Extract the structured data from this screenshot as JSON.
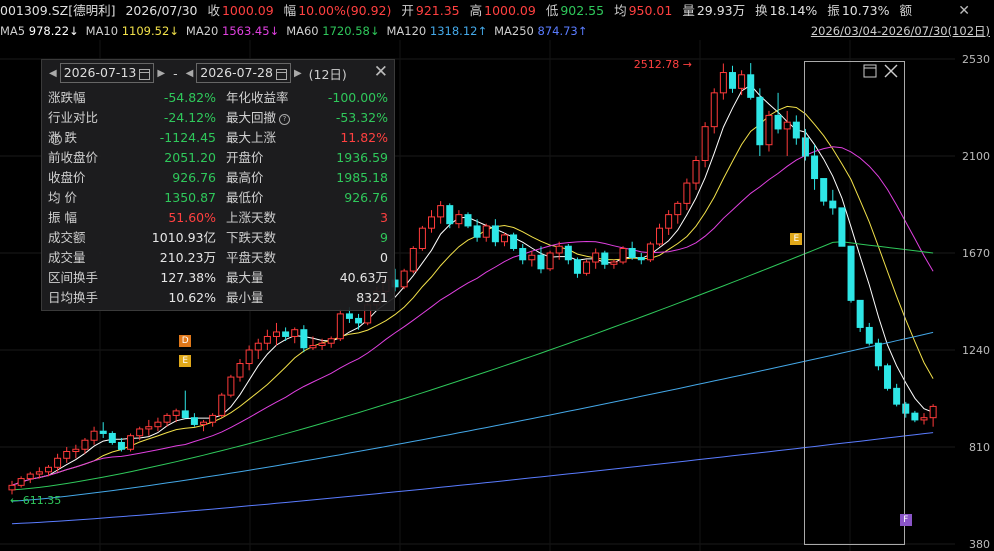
{
  "header": {
    "code_name": "001309.SZ[德明利]",
    "date": "2026/07/30",
    "close_label": "收",
    "close": "1000.09",
    "chg_label": "幅",
    "chg": "10.00%(90.92)",
    "open_label": "开",
    "open": "921.35",
    "high_label": "高",
    "high": "1000.09",
    "low_label": "低",
    "low": "902.55",
    "avg_label": "均",
    "avg": "950.01",
    "vol_label": "量",
    "vol": "29.93万",
    "turn_label": "换",
    "turn": "18.14%",
    "amp_label": "振",
    "amp": "10.73%",
    "amt_label": "额",
    "close_icon": "x-icon"
  },
  "ma_legend": [
    {
      "name": "MA5",
      "value": "978.22↓",
      "color": "#ffffff"
    },
    {
      "name": "MA10",
      "value": "1109.52↓",
      "color": "#f2e14a"
    },
    {
      "name": "MA20",
      "value": "1563.45↓",
      "color": "#e040e0"
    },
    {
      "name": "MA60",
      "value": "1720.58↓",
      "color": "#2fc85b"
    },
    {
      "name": "MA120",
      "value": "1318.12↑",
      "color": "#44a8e8"
    },
    {
      "name": "MA250",
      "value": "874.73↑",
      "color": "#5a7cff"
    }
  ],
  "range_label": "2026/03/04-2026/07/30(102日)",
  "panel": {
    "start_date": "2026-07-13",
    "sep": "-",
    "end_date": "2026-07-28",
    "days": "(12日)",
    "rows": [
      {
        "l1": "涨跌幅",
        "v1": "-54.82%",
        "c1": "g",
        "l2": "年化收益率",
        "v2": "-100.00%",
        "c2": "g"
      },
      {
        "l1": "行业对比",
        "q1": true,
        "v1": "-24.12%",
        "c1": "g",
        "l2": "最大回撤",
        "q2": true,
        "v2": "-53.32%",
        "c2": "g"
      },
      {
        "l1": "涨 跌",
        "v1": "-1124.45",
        "c1": "g",
        "l2": "最大上涨",
        "v2": "11.82%",
        "c2": "r"
      },
      {
        "l1": "前收盘价",
        "v1": "2051.20",
        "c1": "g",
        "l2": "开盘价",
        "v2": "1936.59",
        "c2": "g"
      },
      {
        "l1": "收盘价",
        "v1": "926.76",
        "c1": "g",
        "l2": "最高价",
        "v2": "1985.18",
        "c2": "g"
      },
      {
        "l1": "均 价",
        "v1": "1350.87",
        "c1": "g",
        "l2": "最低价",
        "v2": "926.76",
        "c2": "g"
      },
      {
        "l1": "振 幅",
        "v1": "51.60%",
        "c1": "r",
        "l2": "上涨天数",
        "v2": "3",
        "c2": "r"
      },
      {
        "l1": "成交额",
        "v1": "1010.93亿",
        "c1": "w",
        "l2": "下跌天数",
        "v2": "9",
        "c2": "g"
      },
      {
        "l1": "成交量",
        "v1": "210.23万",
        "c1": "w",
        "l2": "平盘天数",
        "v2": "0",
        "c2": "w"
      },
      {
        "l1": "区间换手",
        "v1": "127.38%",
        "c1": "w",
        "l2": "最大量",
        "v2": "40.63万",
        "c2": "w"
      },
      {
        "l1": "日均换手",
        "v1": "10.62%",
        "c1": "w",
        "l2": "最小量",
        "v2": "8321",
        "c2": "w"
      }
    ]
  },
  "colors": {
    "up": "#ff3b3b",
    "down": "#2ee6e6",
    "ma5": "#ffffff",
    "ma10": "#f2e14a",
    "ma20": "#e040e0",
    "ma60": "#2fc85b",
    "ma120": "#44a8e8",
    "ma250": "#5a7cff",
    "bg": "#000000"
  },
  "chart_data": {
    "type": "candlestick",
    "ylim": [
      380,
      2530
    ],
    "yticks": [
      "2530",
      "2100",
      "1670",
      "1240",
      "810",
      "380"
    ],
    "annotations": {
      "high": "2512.78",
      "low": "611.35"
    },
    "events": [
      {
        "label": "D",
        "color": "#e0781a",
        "idx": 19,
        "price": 1280
      },
      {
        "label": "E",
        "color": "#e0a81a",
        "idx": 19,
        "price": 1190
      },
      {
        "label": "E",
        "color": "#e0a81a",
        "idx": 86,
        "price": 1730
      },
      {
        "label": "F",
        "color": "#8a55c8",
        "idx": 98,
        "price": 487
      }
    ],
    "candles": [
      [
        620,
        660,
        600,
        640
      ],
      [
        640,
        680,
        630,
        670
      ],
      [
        670,
        700,
        650,
        690
      ],
      [
        690,
        720,
        670,
        700
      ],
      [
        700,
        730,
        680,
        720
      ],
      [
        720,
        780,
        700,
        760
      ],
      [
        760,
        810,
        740,
        790
      ],
      [
        790,
        820,
        760,
        800
      ],
      [
        800,
        850,
        780,
        840
      ],
      [
        840,
        900,
        820,
        880
      ],
      [
        880,
        920,
        850,
        870
      ],
      [
        870,
        880,
        820,
        830
      ],
      [
        830,
        850,
        790,
        800
      ],
      [
        800,
        870,
        790,
        860
      ],
      [
        860,
        900,
        840,
        890
      ],
      [
        890,
        930,
        860,
        900
      ],
      [
        900,
        940,
        880,
        920
      ],
      [
        920,
        960,
        900,
        950
      ],
      [
        950,
        980,
        920,
        970
      ],
      [
        970,
        1060,
        960,
        940
      ],
      [
        940,
        960,
        900,
        910
      ],
      [
        910,
        930,
        880,
        920
      ],
      [
        920,
        960,
        900,
        950
      ],
      [
        950,
        1050,
        940,
        1040
      ],
      [
        1040,
        1130,
        1030,
        1120
      ],
      [
        1120,
        1200,
        1100,
        1180
      ],
      [
        1180,
        1260,
        1150,
        1240
      ],
      [
        1240,
        1290,
        1200,
        1270
      ],
      [
        1270,
        1330,
        1240,
        1300
      ],
      [
        1300,
        1360,
        1260,
        1320
      ],
      [
        1320,
        1340,
        1280,
        1300
      ],
      [
        1300,
        1340,
        1270,
        1330
      ],
      [
        1330,
        1350,
        1230,
        1250
      ],
      [
        1250,
        1300,
        1240,
        1260
      ],
      [
        1260,
        1290,
        1240,
        1270
      ],
      [
        1270,
        1300,
        1250,
        1290
      ],
      [
        1290,
        1420,
        1280,
        1400
      ],
      [
        1400,
        1430,
        1360,
        1380
      ],
      [
        1380,
        1400,
        1330,
        1360
      ],
      [
        1360,
        1450,
        1350,
        1440
      ],
      [
        1440,
        1520,
        1420,
        1500
      ],
      [
        1500,
        1560,
        1470,
        1550
      ],
      [
        1550,
        1600,
        1500,
        1520
      ],
      [
        1520,
        1600,
        1510,
        1590
      ],
      [
        1590,
        1700,
        1580,
        1690
      ],
      [
        1690,
        1790,
        1680,
        1780
      ],
      [
        1780,
        1860,
        1760,
        1830
      ],
      [
        1830,
        1900,
        1800,
        1880
      ],
      [
        1880,
        1890,
        1780,
        1800
      ],
      [
        1800,
        1860,
        1780,
        1840
      ],
      [
        1840,
        1850,
        1780,
        1790
      ],
      [
        1790,
        1820,
        1720,
        1740
      ],
      [
        1740,
        1800,
        1720,
        1790
      ],
      [
        1790,
        1820,
        1700,
        1720
      ],
      [
        1720,
        1760,
        1700,
        1750
      ],
      [
        1750,
        1760,
        1680,
        1690
      ],
      [
        1690,
        1710,
        1620,
        1640
      ],
      [
        1640,
        1680,
        1610,
        1660
      ],
      [
        1660,
        1700,
        1580,
        1600
      ],
      [
        1600,
        1680,
        1590,
        1670
      ],
      [
        1670,
        1720,
        1640,
        1700
      ],
      [
        1700,
        1710,
        1620,
        1640
      ],
      [
        1640,
        1650,
        1560,
        1580
      ],
      [
        1580,
        1640,
        1570,
        1630
      ],
      [
        1630,
        1690,
        1600,
        1670
      ],
      [
        1670,
        1680,
        1600,
        1620
      ],
      [
        1620,
        1640,
        1600,
        1630
      ],
      [
        1630,
        1700,
        1620,
        1690
      ],
      [
        1690,
        1720,
        1640,
        1650
      ],
      [
        1650,
        1670,
        1620,
        1640
      ],
      [
        1640,
        1720,
        1630,
        1710
      ],
      [
        1710,
        1800,
        1700,
        1780
      ],
      [
        1780,
        1860,
        1750,
        1840
      ],
      [
        1840,
        1900,
        1800,
        1890
      ],
      [
        1890,
        2000,
        1860,
        1980
      ],
      [
        1980,
        2100,
        1950,
        2080
      ],
      [
        2080,
        2250,
        2050,
        2230
      ],
      [
        2230,
        2400,
        2200,
        2380
      ],
      [
        2380,
        2510,
        2350,
        2470
      ],
      [
        2470,
        2500,
        2380,
        2400
      ],
      [
        2400,
        2480,
        2370,
        2460
      ],
      [
        2460,
        2512,
        2350,
        2360
      ],
      [
        2360,
        2400,
        2100,
        2150
      ],
      [
        2150,
        2300,
        2120,
        2280
      ],
      [
        2280,
        2380,
        2200,
        2220
      ],
      [
        2220,
        2300,
        2100,
        2250
      ],
      [
        2250,
        2280,
        2150,
        2180
      ],
      [
        2180,
        2220,
        2080,
        2100
      ],
      [
        2100,
        2150,
        1950,
        2000
      ],
      [
        2000,
        2000,
        1880,
        1900
      ],
      [
        1900,
        1950,
        1840,
        1870
      ],
      [
        1870,
        1870,
        1700,
        1700
      ],
      [
        1700,
        1700,
        1450,
        1460
      ],
      [
        1460,
        1460,
        1320,
        1340
      ],
      [
        1340,
        1360,
        1260,
        1270
      ],
      [
        1270,
        1290,
        1150,
        1170
      ],
      [
        1170,
        1180,
        1060,
        1070
      ],
      [
        1070,
        1090,
        990,
        1000
      ],
      [
        1000,
        1010,
        940,
        960
      ],
      [
        960,
        970,
        920,
        930
      ],
      [
        930,
        960,
        910,
        940
      ],
      [
        940,
        1000,
        900,
        990
      ]
    ]
  }
}
